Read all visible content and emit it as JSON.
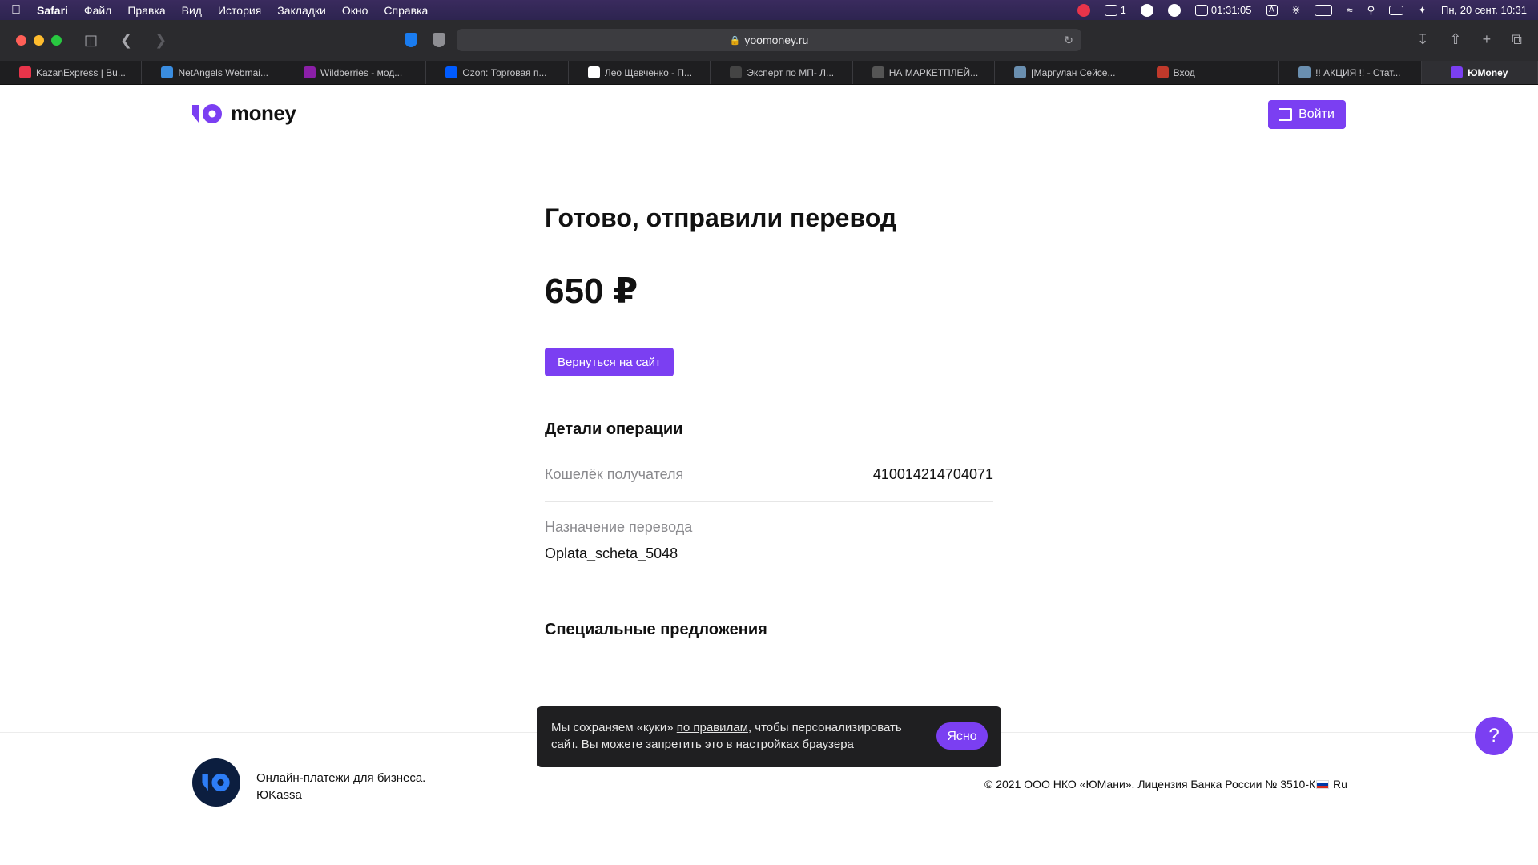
{
  "menubar": {
    "app": "Safari",
    "items": [
      "Файл",
      "Правка",
      "Вид",
      "История",
      "Закладки",
      "Окно",
      "Справка"
    ],
    "badge_count": "1",
    "timer": "01:31:05",
    "keyboard": "A",
    "datetime": "Пн, 20 сент.  10:31"
  },
  "browser": {
    "url": "yoomoney.ru",
    "tabs": [
      {
        "label": "KazanExpress | Bu...",
        "color": "#e8344a",
        "icon": "kazanexpress-favicon"
      },
      {
        "label": "NetAngels Webmai...",
        "color": "#3a8de0",
        "icon": "netangels-favicon"
      },
      {
        "label": "Wildberries - мод...",
        "color": "#8b1fa8",
        "icon": "wildberries-favicon"
      },
      {
        "label": "Ozon: Торговая п...",
        "color": "#005bff",
        "icon": "ozon-favicon"
      },
      {
        "label": "Лео Щевченко - П...",
        "color": "#ffffff",
        "icon": "google-favicon"
      },
      {
        "label": "Эксперт по МП- Л...",
        "color": "#444444",
        "icon": "instagram-favicon"
      },
      {
        "label": "НА МАРКЕТПЛЕЙ...",
        "color": "#555555",
        "icon": "book-favicon"
      },
      {
        "label": "[Маргулан Сейсе...",
        "color": "#6a8fb0",
        "icon": "image-favicon"
      },
      {
        "label": "Вход",
        "color": "#c0392b",
        "icon": "login-favicon"
      },
      {
        "label": "!! АКЦИЯ !! - Стат...",
        "color": "#6a8fb0",
        "icon": "image-favicon"
      },
      {
        "label": "ЮMoney",
        "color": "#7b3ff2",
        "icon": "yoomoney-favicon"
      }
    ]
  },
  "header": {
    "logo_text": "money",
    "login_label": "Войти"
  },
  "main": {
    "title": "Готово, отправили перевод",
    "amount": "650 ₽",
    "back_button": "Вернуться на сайт",
    "details_title": "Детали операции",
    "wallet_label": "Кошелёк получателя",
    "wallet_value": "410014214704071",
    "purpose_label": "Назначение перевода",
    "purpose_value": "Oplata_scheta_5048",
    "special_title": "Специальные предложения"
  },
  "footer": {
    "tagline_line1": "Онлайн-платежи для бизнеса.",
    "tagline_line2": "ЮKassa",
    "copyright": "© 2021 ООО НКО «ЮМани». Лицензия Банка России № 3510-К",
    "language": "Ru"
  },
  "cookie": {
    "text_before": "Мы сохраняем «куки» ",
    "link": "по правилам",
    "text_after": ", чтобы персонализировать сайт. Вы можете запретить это в настройках браузера",
    "button": "Ясно"
  },
  "help": {
    "label": "?"
  },
  "colors": {
    "accent": "#7b3ff2",
    "footer_logo": "#0c1e3f"
  }
}
